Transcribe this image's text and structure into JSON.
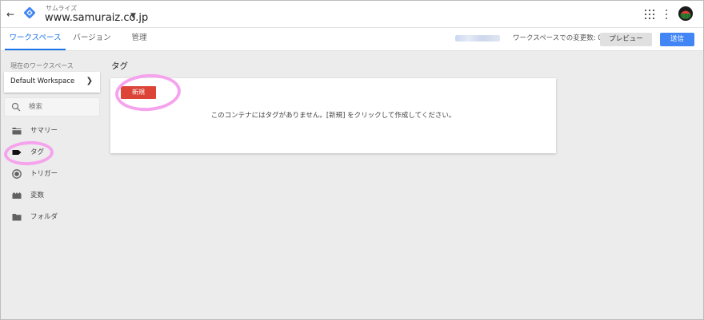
{
  "header": {
    "back_icon": "arrow-back-icon",
    "account_name": "サムライズ",
    "container_name": "www.samuraiz.co.jp",
    "logo_color": "#4285f4"
  },
  "tabs": [
    {
      "label": "ワークスペース",
      "active": true
    },
    {
      "label": "バージョン",
      "active": false
    },
    {
      "label": "管理",
      "active": false
    }
  ],
  "toolbar": {
    "workspace_changes": "ワークスペースでの変更数: 0",
    "preview_label": "プレビュー",
    "submit_label": "送信"
  },
  "sidebar": {
    "current_workspace_label": "現在のワークスペース",
    "workspace_name": "Default Workspace",
    "search_placeholder": "検索",
    "items": [
      {
        "label": "サマリー",
        "icon": "summary-icon"
      },
      {
        "label": "タグ",
        "icon": "tag-icon"
      },
      {
        "label": "トリガー",
        "icon": "trigger-icon"
      },
      {
        "label": "変数",
        "icon": "variable-icon"
      },
      {
        "label": "フォルダ",
        "icon": "folder-icon"
      }
    ]
  },
  "main": {
    "title": "タグ",
    "new_button": "新規",
    "empty_message": "このコンテナにはタグがありません。[新規] をクリックして作成してください。"
  },
  "colors": {
    "accent": "#1a73e8",
    "new_button": "#db4437",
    "submit_button": "#4285f4",
    "highlighter": "#f6a3ee"
  }
}
